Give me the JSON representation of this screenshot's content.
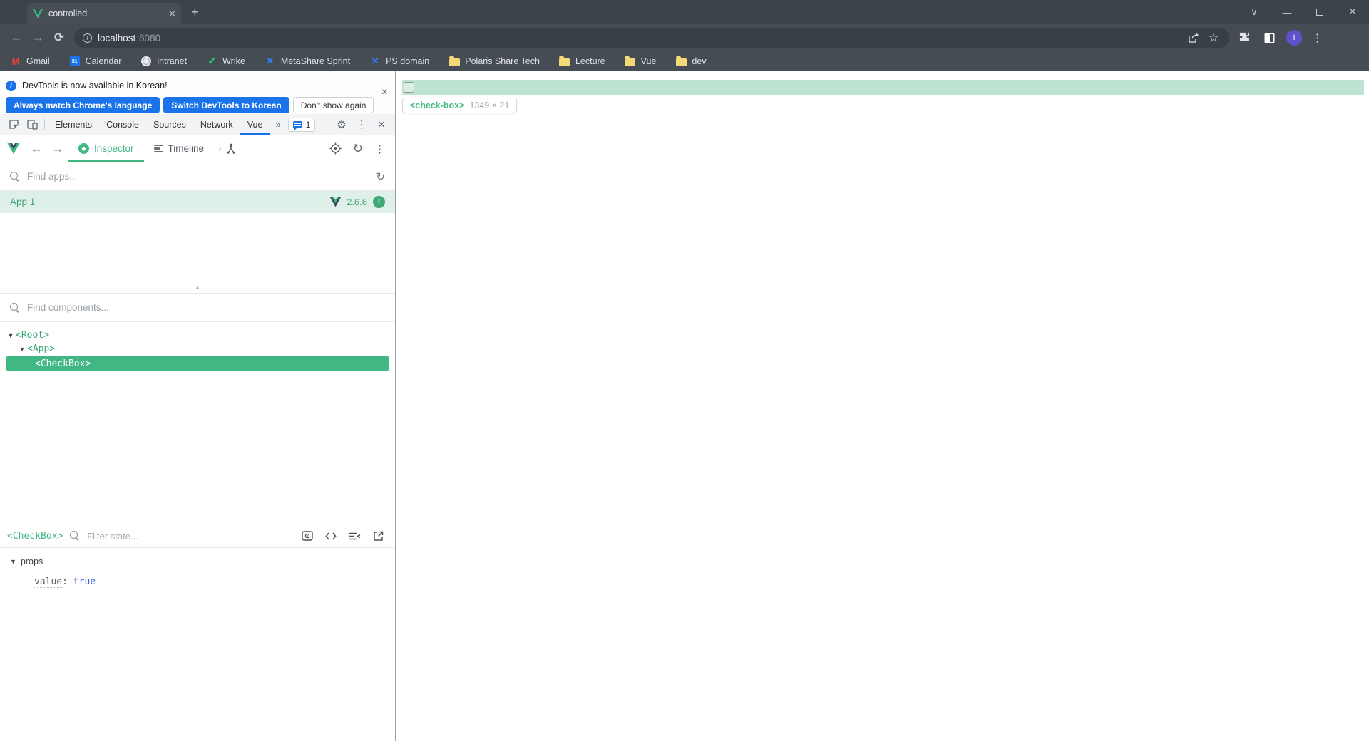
{
  "browser": {
    "tab": {
      "title": "controlled"
    },
    "url": {
      "host": "localhost",
      "port": ":8080"
    },
    "avatar_initial": "I",
    "bookmarks": [
      {
        "label": "Gmail"
      },
      {
        "label": "Calendar"
      },
      {
        "label": "intranet"
      },
      {
        "label": "Wrike"
      },
      {
        "label": "MetaShare Sprint"
      },
      {
        "label": "PS domain"
      },
      {
        "label": "Polaris Share Tech"
      },
      {
        "label": "Lecture"
      },
      {
        "label": "Vue"
      },
      {
        "label": "dev"
      }
    ],
    "calendar_icon_day": "31"
  },
  "devtools": {
    "notification": {
      "message": "DevTools is now available in Korean!",
      "buttons": [
        "Always match Chrome's language",
        "Switch DevTools to Korean",
        "Don't show again"
      ]
    },
    "tabs": [
      "Elements",
      "Console",
      "Sources",
      "Network",
      "Vue"
    ],
    "issues_count": "1",
    "vue": {
      "toolbar": {
        "inspector": "Inspector",
        "timeline": "Timeline"
      },
      "find_apps_placeholder": "Find apps...",
      "app": {
        "name": "App 1",
        "version": "2.6.6",
        "badge": "!"
      },
      "find_components_placeholder": "Find components...",
      "tree": [
        {
          "label": "<Root>"
        },
        {
          "label": "<App>"
        },
        {
          "label": "<CheckBox>"
        }
      ],
      "state": {
        "component": "<CheckBox>",
        "filter_placeholder": "Filter state...",
        "section": "props",
        "prop_key": "value",
        "prop_colon": ":",
        "prop_value": "true"
      }
    }
  },
  "page": {
    "highlight_tooltip": {
      "tag": "<check-box>",
      "size": "1349 × 21"
    }
  },
  "colors": {
    "vue_green": "#42b983",
    "chrome_blue": "#1a73e8",
    "highlight": "#bfe3d1"
  }
}
